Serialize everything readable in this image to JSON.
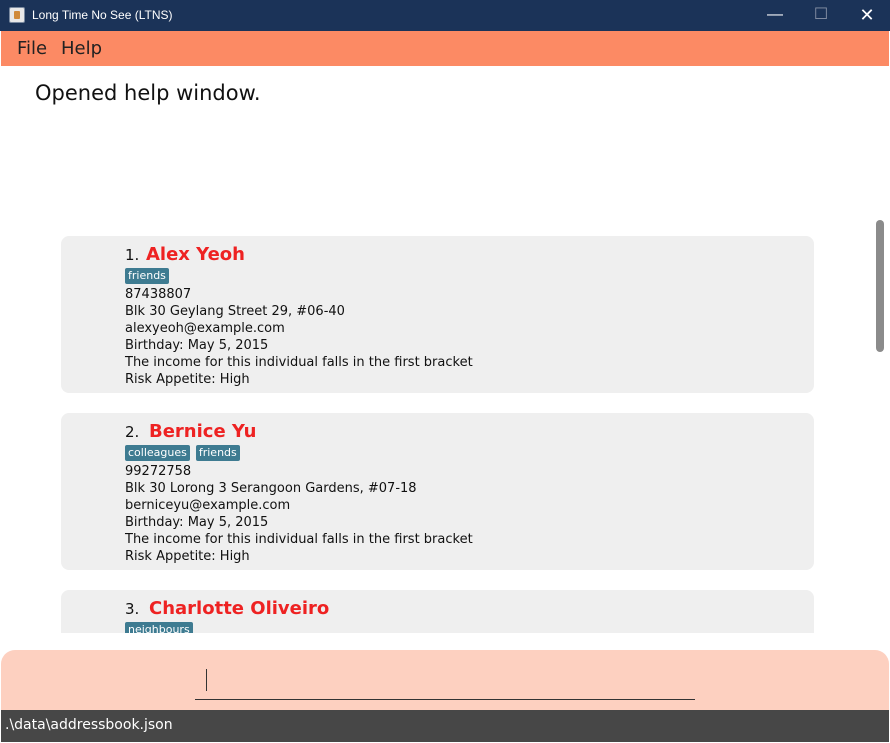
{
  "window": {
    "title": "Long Time No See (LTNS)",
    "minimize": "—",
    "maximize": "☐",
    "close": "✕"
  },
  "menu": {
    "file": "File",
    "help": "Help"
  },
  "result": {
    "text": "Opened help window."
  },
  "persons": [
    {
      "index": "1.",
      "name": "Alex Yeoh",
      "tags": [
        "friends"
      ],
      "phone": "87438807",
      "address": "Blk 30 Geylang Street 29, #06-40",
      "email": "alexyeoh@example.com",
      "birthday": "Birthday: May 5, 2015",
      "income": "The income for this individual falls in the first bracket",
      "risk": "Risk Appetite: High"
    },
    {
      "index": "2.",
      "name": "Bernice Yu",
      "tags": [
        "colleagues",
        "friends"
      ],
      "phone": "99272758",
      "address": "Blk 30 Lorong 3 Serangoon Gardens, #07-18",
      "email": "berniceyu@example.com",
      "birthday": "Birthday: May 5, 2015",
      "income": "The income for this individual falls in the first bracket",
      "risk": "Risk Appetite: High"
    },
    {
      "index": "3.",
      "name": "Charlotte Oliveiro",
      "tags": [
        "neighbours"
      ]
    }
  ],
  "command": {
    "value": ""
  },
  "status": {
    "path": ".\\data\\addressbook.json"
  },
  "colors": {
    "menubar": "#fc8a64",
    "name": "#ee2222",
    "tag": "#3e7b91",
    "command_area": "#fdd0c0",
    "statusbar": "#474747",
    "titlebar": "#1b3358"
  }
}
